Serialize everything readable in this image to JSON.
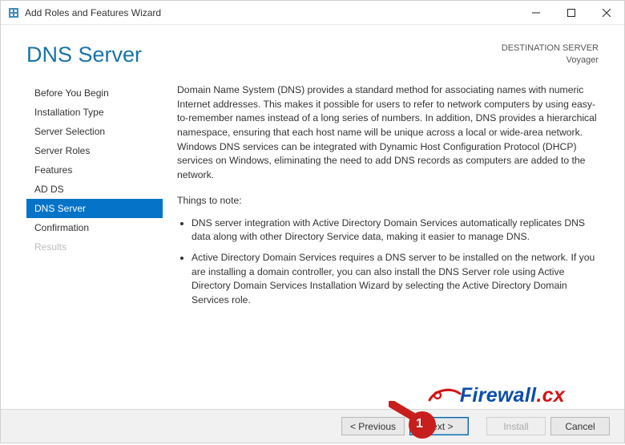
{
  "titlebar": {
    "title": "Add Roles and Features Wizard"
  },
  "header": {
    "page_title": "DNS Server",
    "dest_label": "DESTINATION SERVER",
    "dest_value": "Voyager"
  },
  "sidebar": {
    "steps": [
      {
        "label": "Before You Begin",
        "state": "normal"
      },
      {
        "label": "Installation Type",
        "state": "normal"
      },
      {
        "label": "Server Selection",
        "state": "normal"
      },
      {
        "label": "Server Roles",
        "state": "normal"
      },
      {
        "label": "Features",
        "state": "normal"
      },
      {
        "label": "AD DS",
        "state": "normal"
      },
      {
        "label": "DNS Server",
        "state": "active"
      },
      {
        "label": "Confirmation",
        "state": "normal"
      },
      {
        "label": "Results",
        "state": "disabled"
      }
    ]
  },
  "content": {
    "intro": "Domain Name System (DNS) provides a standard method for associating names with numeric Internet addresses. This makes it possible for users to refer to network computers by using easy-to-remember names instead of a long series of numbers. In addition, DNS provides a hierarchical namespace, ensuring that each host name will be unique across a local or wide-area network. Windows DNS services can be integrated with Dynamic Host Configuration Protocol (DHCP) services on Windows, eliminating the need to add DNS records as computers are added to the network.",
    "note_heading": "Things to note:",
    "bullets": [
      "DNS server integration with Active Directory Domain Services automatically replicates DNS data along with other Directory Service data, making it easier to manage DNS.",
      "Active Directory Domain Services requires a DNS server to be installed on the network. If you are installing a domain controller, you can also install the DNS Server role using Active Directory Domain Services Installation Wizard by selecting the Active Directory Domain Services role."
    ]
  },
  "footer": {
    "previous": "< Previous",
    "next": "Next >",
    "install": "Install",
    "cancel": "Cancel"
  },
  "watermark": {
    "text_main": "Firewall",
    "text_suffix": ".cx"
  },
  "callout": {
    "number": "1"
  }
}
